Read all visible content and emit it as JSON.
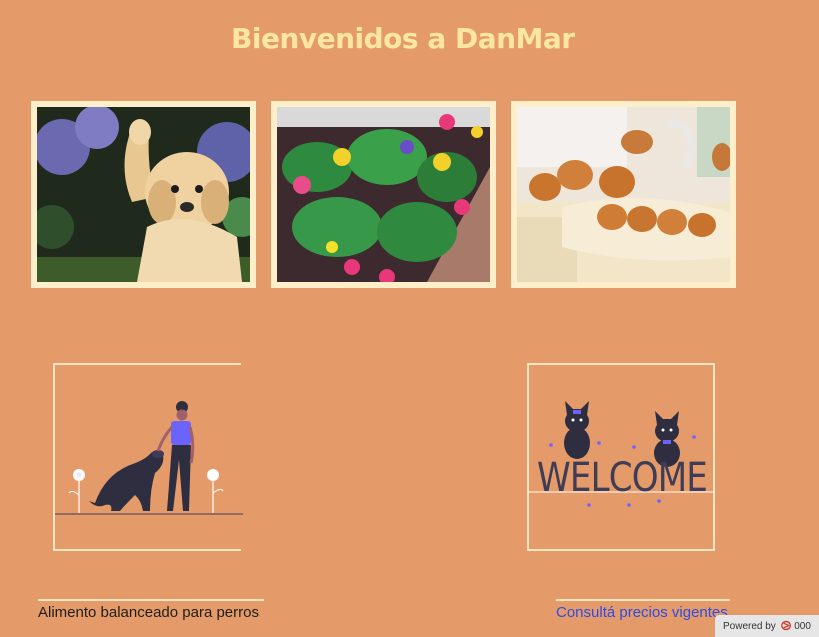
{
  "page": {
    "title": "Bienvenidos a DanMar"
  },
  "gallery": {
    "photos": [
      {
        "name": "puppy-waving-photo"
      },
      {
        "name": "flowers-photo"
      },
      {
        "name": "puppies-in-sink-photo"
      }
    ]
  },
  "illustrations": {
    "left": {
      "name": "woman-with-dog-illustration"
    },
    "right": {
      "name": "welcome-cats-illustration",
      "text": "WELCOME"
    }
  },
  "footer": {
    "left_text": "Alimento balanceado para perros",
    "right_link": "Consultá precios vigentes"
  },
  "badge": {
    "powered_by": "Powered by",
    "brand": "000"
  },
  "colors": {
    "background": "#e59b69",
    "title": "#fce6a5",
    "frame": "#fcefc9",
    "link": "#2c4be8",
    "accent": "#6c63ff"
  }
}
